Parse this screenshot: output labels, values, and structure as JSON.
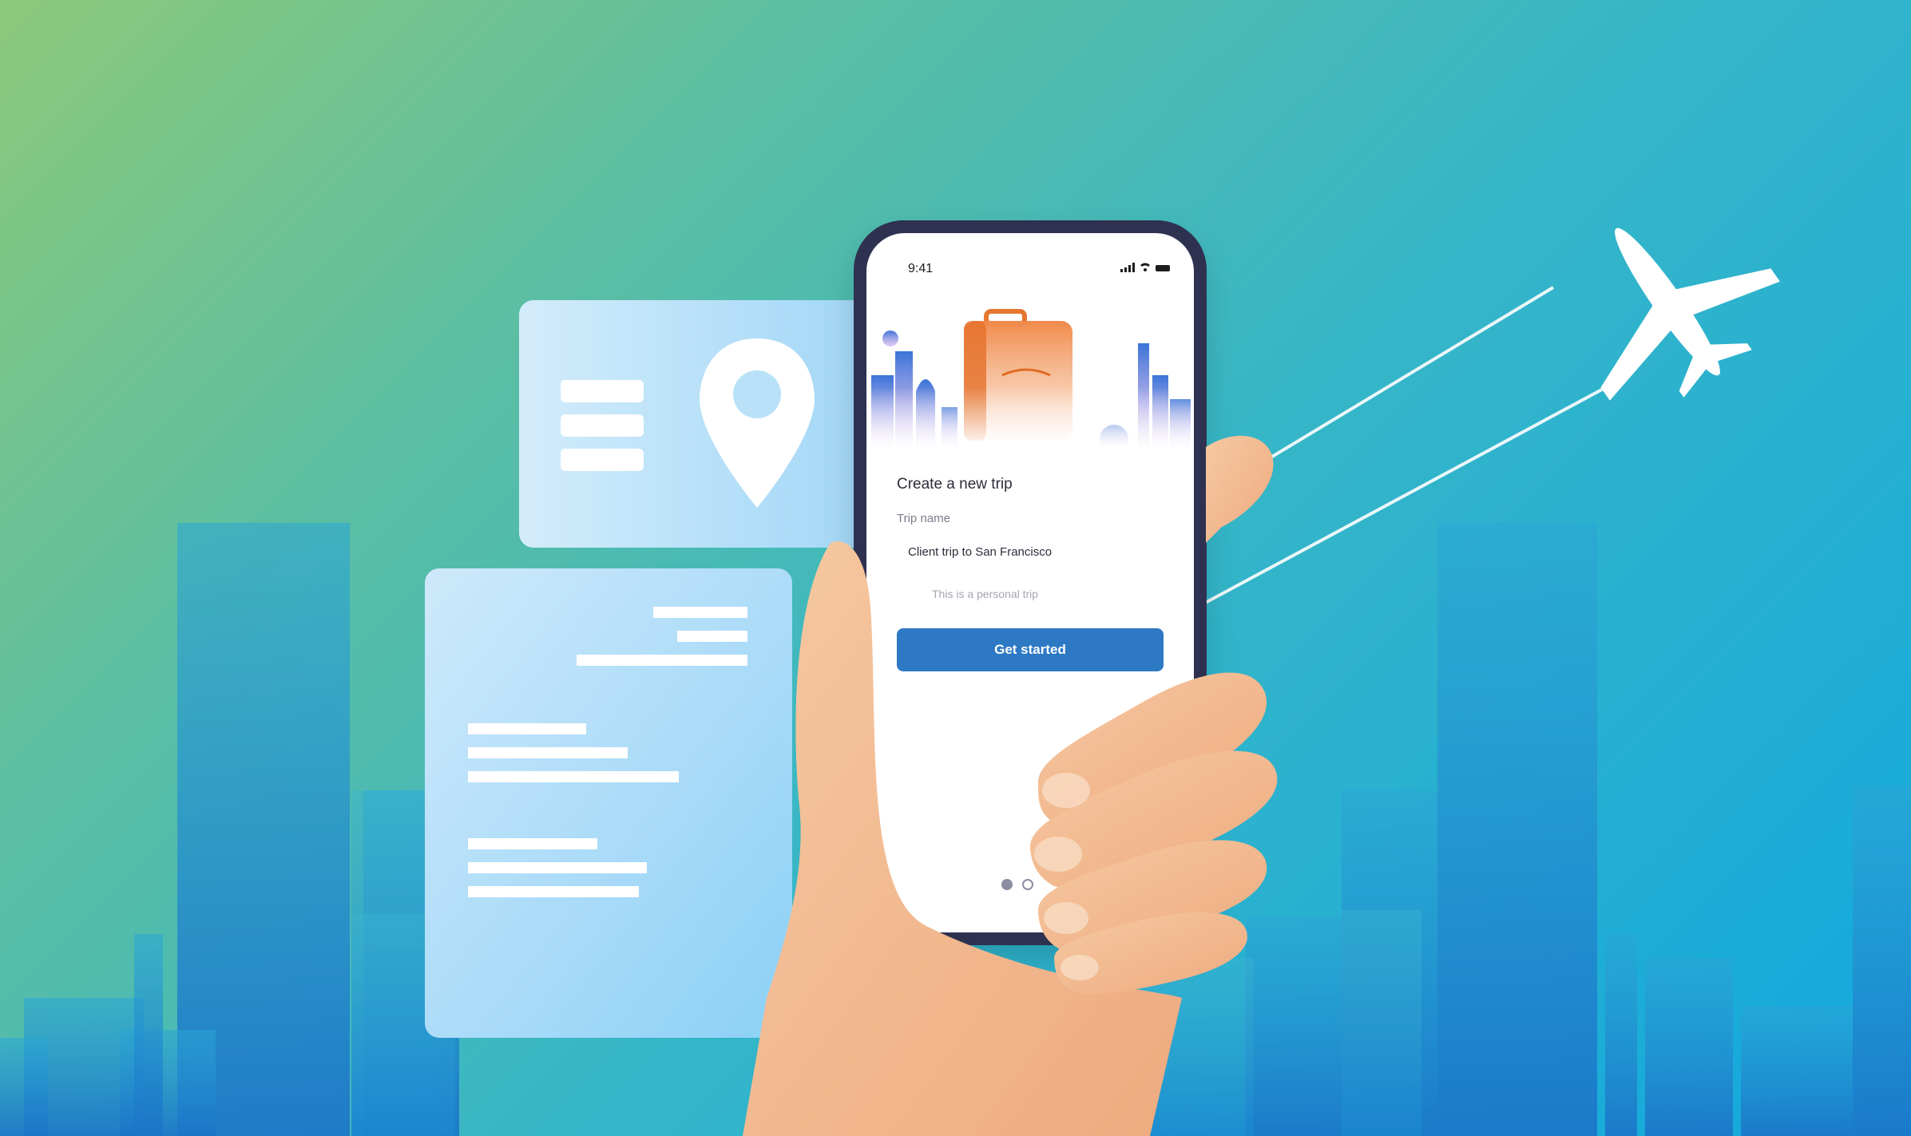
{
  "phone": {
    "status_time": "9:41",
    "title": "Create a new trip",
    "trip_name_label": "Trip name",
    "trip_name_value": "Client trip to San Francisco",
    "personal_trip_label": "This is a personal trip",
    "cta_label": "Get started",
    "page_indicator": {
      "current": 1,
      "total": 2
    }
  },
  "icons": [
    "signal-icon",
    "wifi-icon",
    "battery-icon",
    "map-pin-icon",
    "list-icon",
    "airplane-icon",
    "suitcase-icon"
  ],
  "colors": {
    "accent_button": "#2d79c4",
    "phone_frame": "#2e3250",
    "suitcase": "#f08a4b"
  }
}
